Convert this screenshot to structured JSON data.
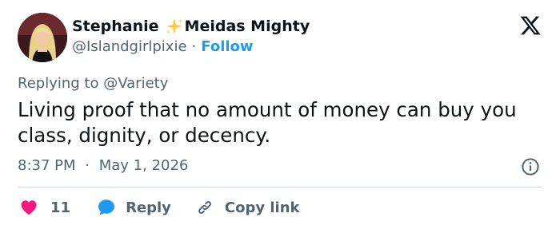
{
  "author": {
    "display_name_part1": "Stephanie",
    "display_name_part2": "Meidas Mighty",
    "handle": "@Islandgirlpixie",
    "separator": "·",
    "follow_label": "Follow"
  },
  "tweet": {
    "replying_prefix": "Replying to",
    "replying_to": "@Variety",
    "text": "Living proof that no amount of money can buy you class, dignity, or decency.",
    "time": "8:37 PM",
    "date_separator": "·",
    "date": "May 1, 2026"
  },
  "actions": {
    "like_count": "11",
    "reply_label": "Reply",
    "copy_link_label": "Copy link"
  },
  "icons": {
    "sparkle": "sparkles-icon",
    "logo": "x-logo-icon",
    "info": "info-icon",
    "like": "heart-icon",
    "reply": "speech-bubble-icon",
    "copy": "link-icon"
  },
  "colors": {
    "accent": "#1d9bf0",
    "like": "#f91880",
    "text": "#0f1419",
    "muted": "#536471",
    "sparkle": "#ffc83d"
  }
}
